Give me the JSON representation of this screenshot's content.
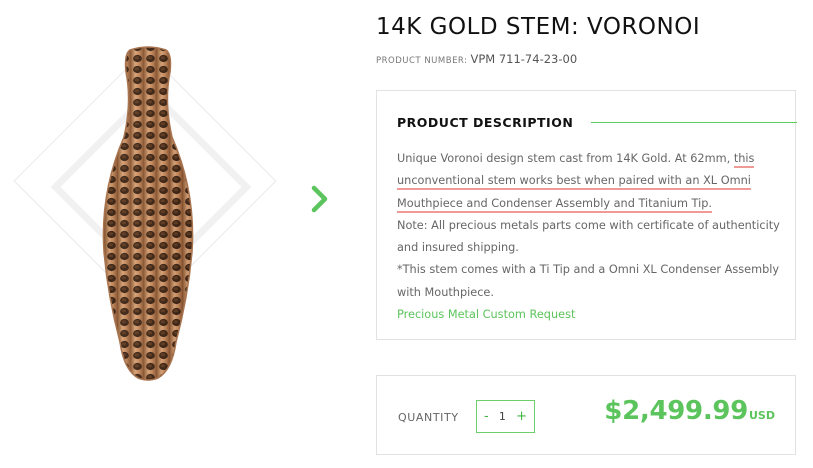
{
  "product": {
    "title": "14K GOLD STEM: VORONOI",
    "number_label": "PRODUCT NUMBER:",
    "number_value": "VPM 711-74-23-00"
  },
  "description": {
    "heading": "PRODUCT DESCRIPTION",
    "text_intro": "Unique Voronoi design stem cast from 14K Gold. At 62mm, ",
    "text_highlight_1": "this",
    "text_highlight_2": "unconventional stem works best when paired with an XL Omni",
    "text_highlight_3": "Mouthpiece and Condenser Assembly and Titanium Tip.",
    "note": "Note: All precious metals parts come with certificate of authenticity and insured shipping.",
    "tip_note": "*This stem comes with a Ti Tip and a Omni XL Condenser Assembly with Mouthpiece.",
    "link": "Precious Metal Custom Request"
  },
  "purchase": {
    "quantity_label": "QUANTITY",
    "decrement": "-",
    "quantity": "1",
    "increment": "+",
    "price": "$2,499.99",
    "currency": "USD"
  },
  "icons": {
    "next": "chevron-right-icon"
  },
  "colors": {
    "accent": "#5cc45c",
    "highlight_underline": "#f09a98"
  }
}
